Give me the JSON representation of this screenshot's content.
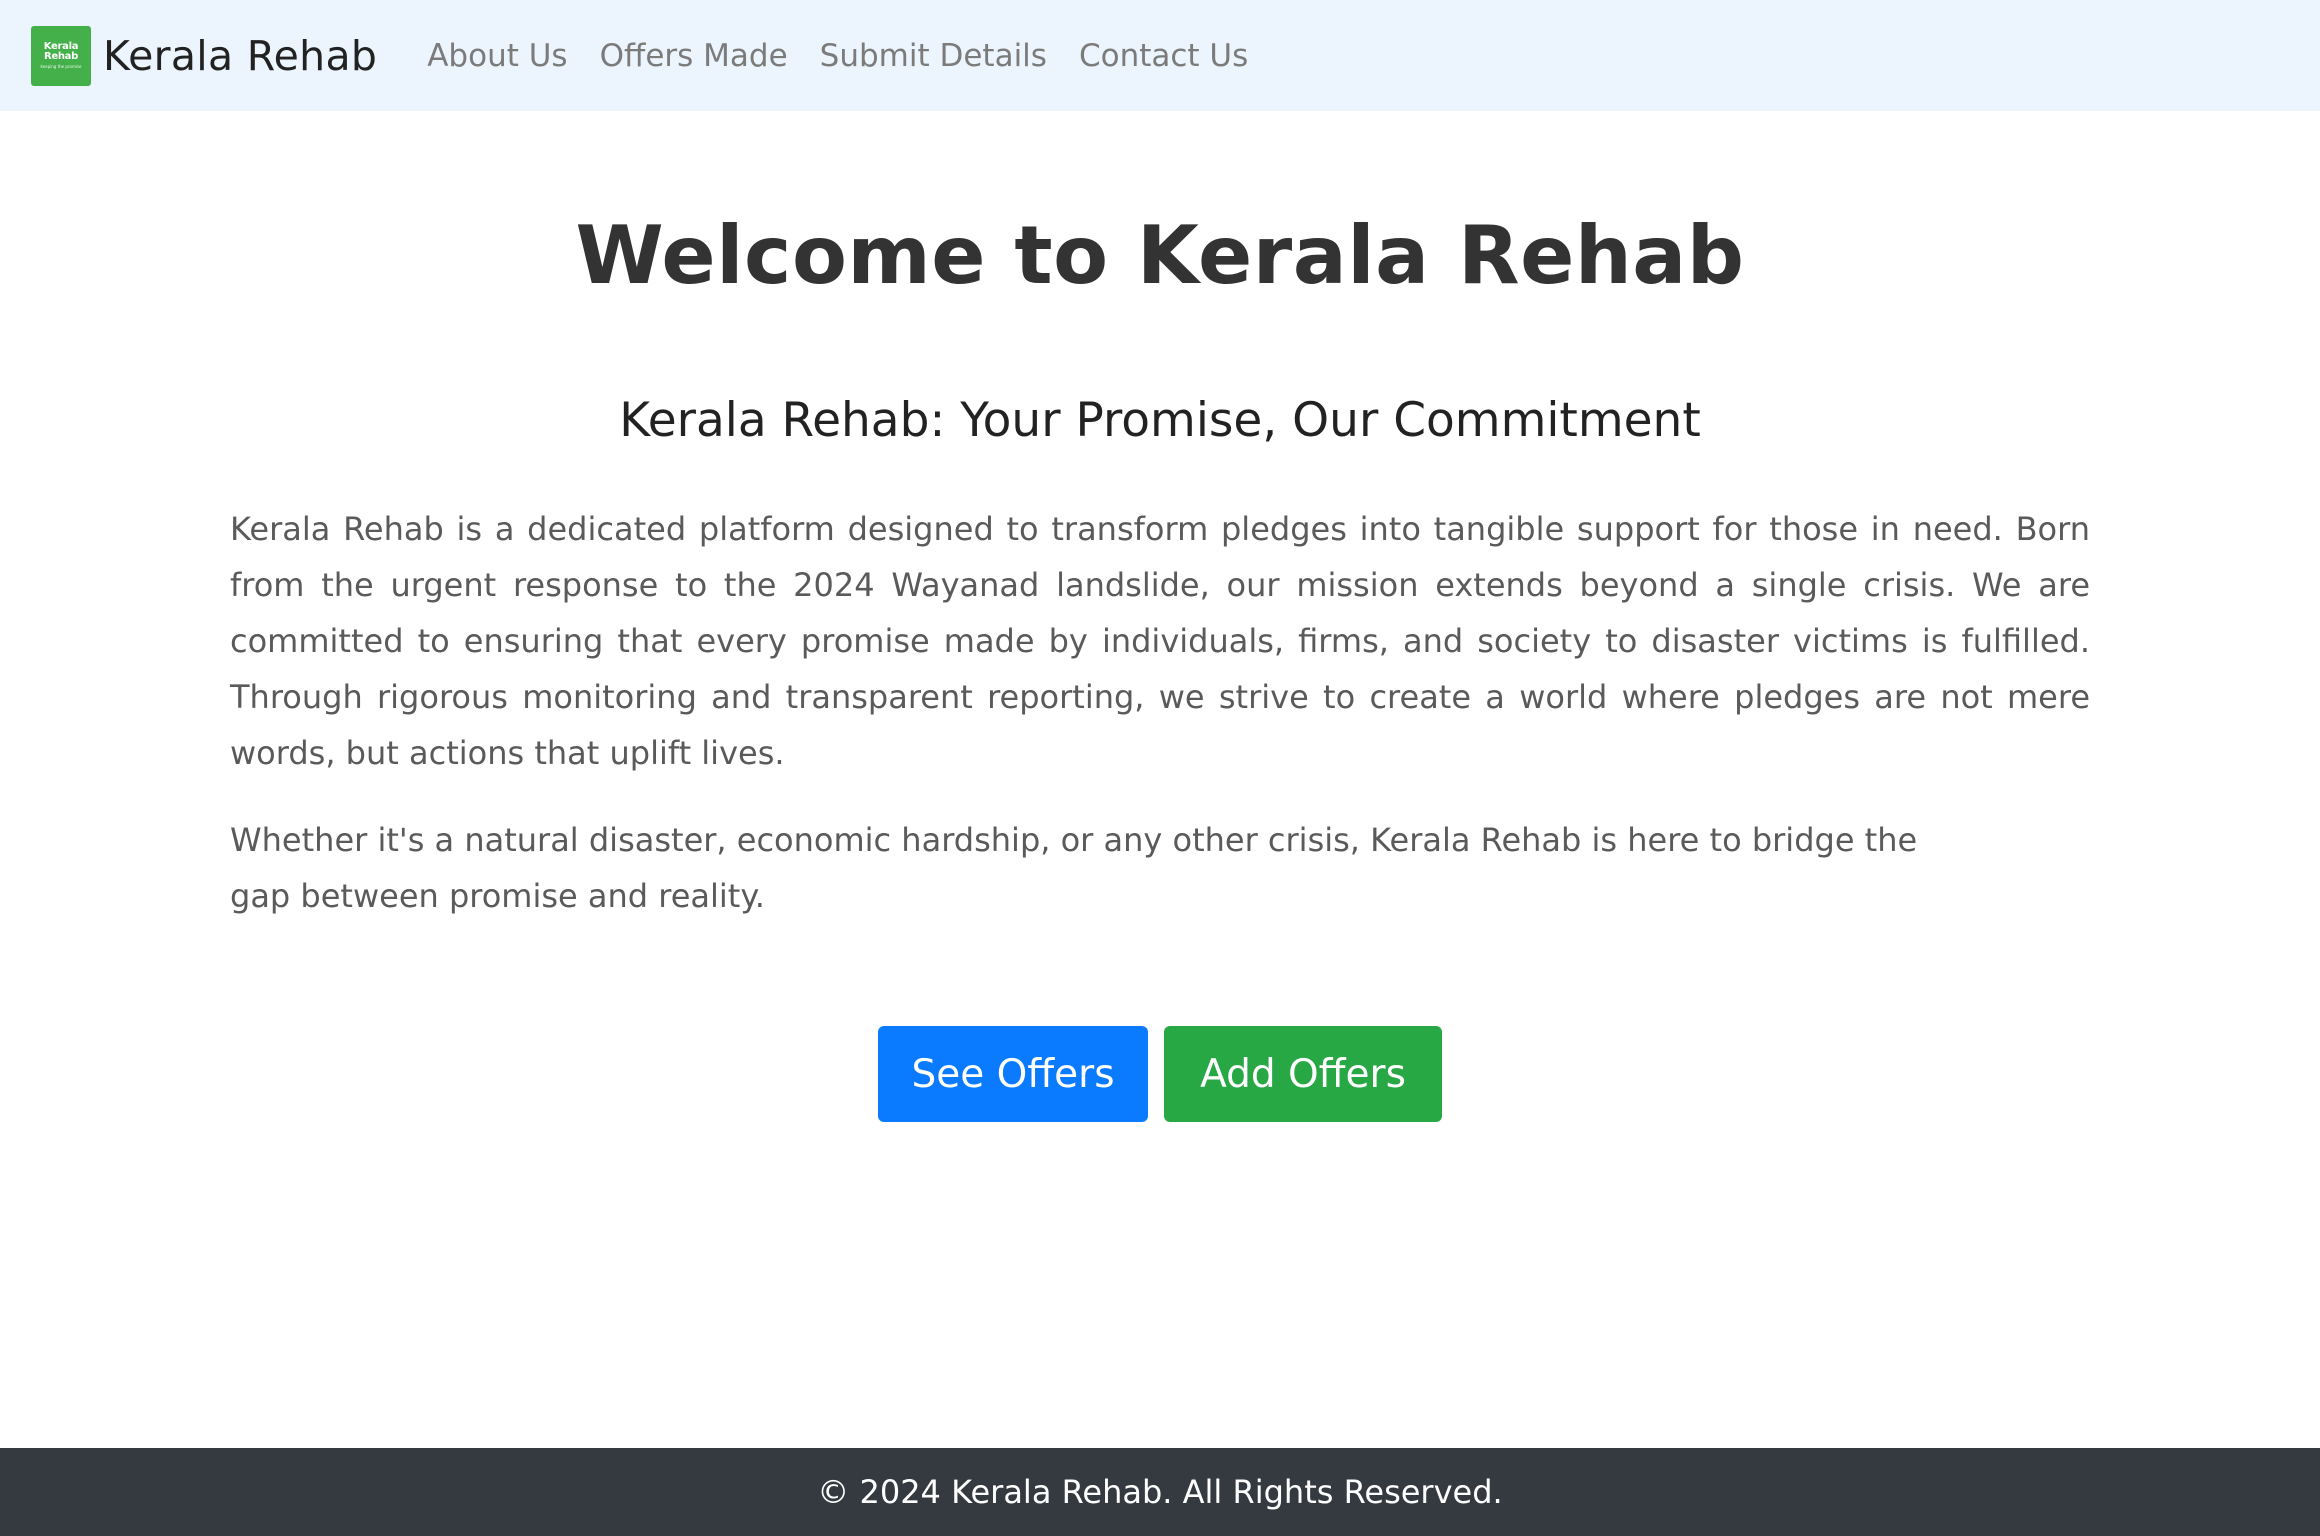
{
  "nav": {
    "logo": {
      "line1": "Kerala",
      "line2": "Rehab",
      "line3": "keeping the promise"
    },
    "brand": "Kerala Rehab",
    "links": [
      {
        "label": "About Us"
      },
      {
        "label": "Offers Made"
      },
      {
        "label": "Submit Details"
      },
      {
        "label": "Contact Us"
      }
    ]
  },
  "main": {
    "title": "Welcome to Kerala Rehab",
    "subtitle": "Kerala Rehab: Your Promise, Our Commitment",
    "paragraph1": "Kerala Rehab is a dedicated platform designed to transform pledges into tangible support for those in need. Born from the urgent response to the 2024 Wayanad landslide, our mission extends beyond a single crisis. We are committed to ensuring that every promise made by individuals, firms, and society to disaster victims is fulfilled. Through rigorous monitoring and transparent reporting, we strive to create a world where pledges are not mere words, but actions that uplift lives.",
    "paragraph2": "Whether it's a natural disaster, economic hardship, or any other crisis, Kerala Rehab is here to bridge the gap between promise and reality.",
    "buttons": {
      "see_offers": "See Offers",
      "add_offers": "Add Offers"
    }
  },
  "footer": {
    "text": "© 2024 Kerala Rehab. All Rights Reserved."
  },
  "colors": {
    "navbar_bg": "#ecf5fd",
    "logo_green": "#43b04a",
    "button_blue": "#0a7bff",
    "button_green": "#28a745",
    "footer_bg": "#343a40"
  }
}
